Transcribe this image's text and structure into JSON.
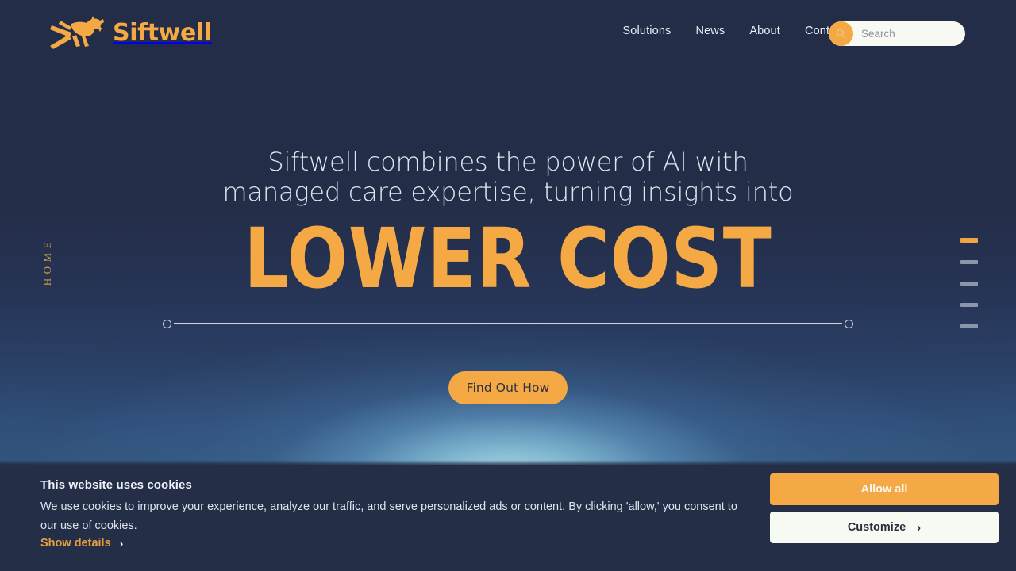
{
  "brand": {
    "name": "Siftwell",
    "logo_icon": "pegasus-logo-icon",
    "accent_color": "#f5a944",
    "background_color": "#242d47"
  },
  "header": {
    "nav": [
      {
        "label": "Solutions"
      },
      {
        "label": "News"
      },
      {
        "label": "About"
      },
      {
        "label": "Contact"
      }
    ],
    "search": {
      "placeholder": "Search",
      "value": "",
      "icon": "search-icon"
    }
  },
  "hero": {
    "side_label": "HOME",
    "headline_line1": "Siftwell combines the power of AI with",
    "headline_line2": "managed care expertise, turning insights into",
    "emphasis_word": "LOWER COST",
    "cta_label": "Find Out How",
    "slider": {
      "left_knob": "slider-knob-left",
      "right_knob": "slider-knob-right"
    },
    "slide_indicators": [
      {
        "active": true
      },
      {
        "active": false
      },
      {
        "active": false
      },
      {
        "active": false
      },
      {
        "active": false
      }
    ]
  },
  "cookie_banner": {
    "title": "This website uses cookies",
    "body": "We use cookies to improve your experience, analyze our traffic, and serve personalized ads or content. By clicking 'allow,' you consent to our use of cookies.",
    "details_link": "Show details",
    "details_chevron": "›",
    "allow_label": "Allow all",
    "customize_label": "Customize",
    "customize_chevron": "›"
  }
}
